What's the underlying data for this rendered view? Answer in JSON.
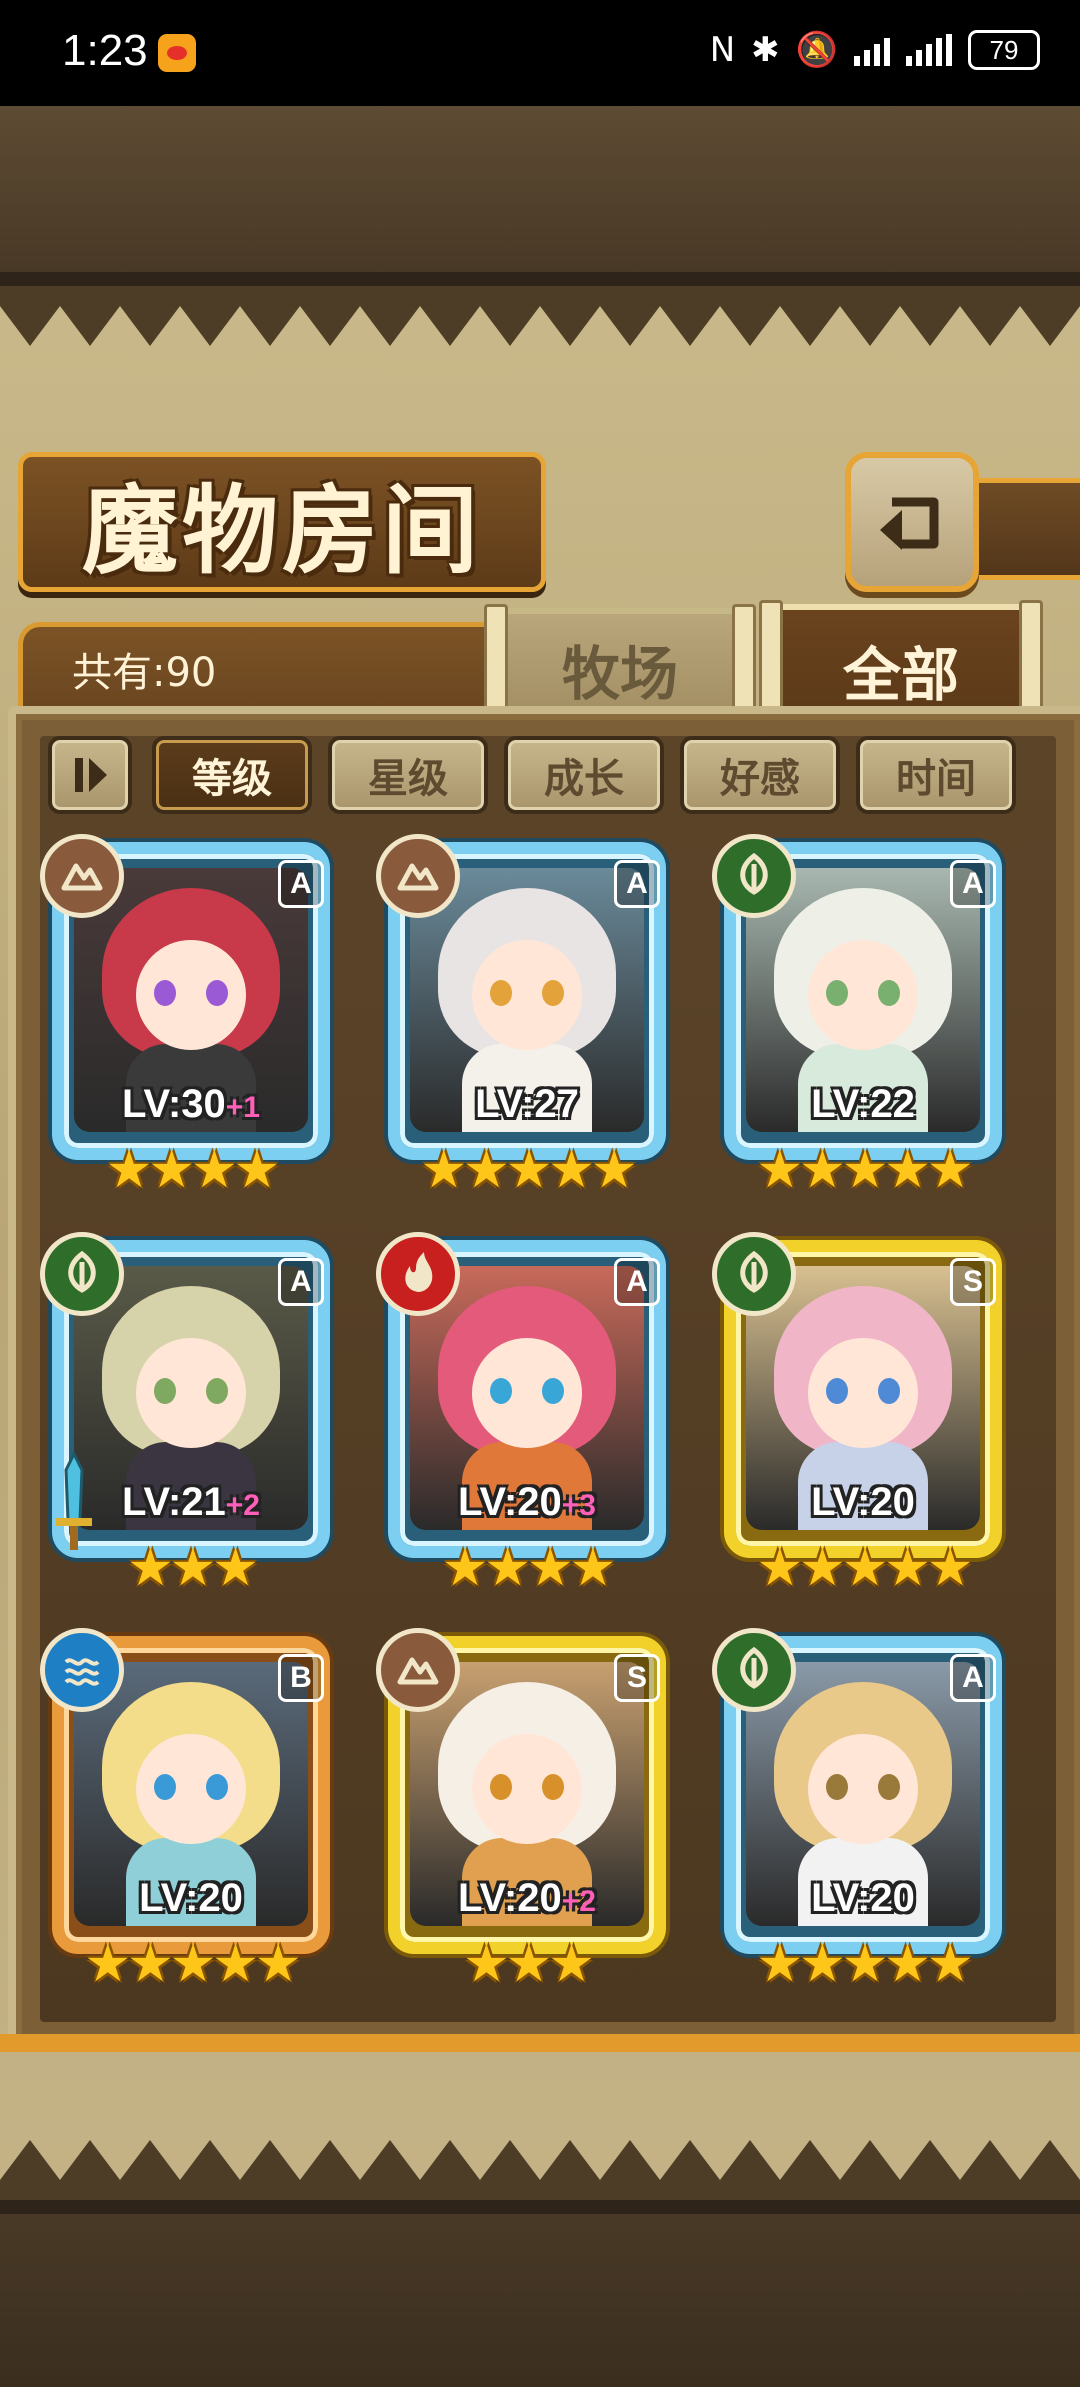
{
  "status_bar": {
    "time": "1:23",
    "battery": "79",
    "icons": [
      "weibo-icon",
      "nfc-icon",
      "bluetooth-icon",
      "mute-icon",
      "signal-icon",
      "signal-4g-icon"
    ]
  },
  "header": {
    "title": "魔物房间",
    "back_icon": "return-icon"
  },
  "tabs": {
    "count_label": "共有:90",
    "items": [
      {
        "label": "牧场",
        "active": false
      },
      {
        "label": "全部",
        "active": true
      }
    ]
  },
  "sort": {
    "toggle_icon": "reverse-order-icon",
    "options": [
      {
        "label": "等级",
        "active": true
      },
      {
        "label": "星级",
        "active": false
      },
      {
        "label": "成长",
        "active": false
      },
      {
        "label": "好感",
        "active": false
      },
      {
        "label": "时间",
        "active": false
      }
    ]
  },
  "colors": {
    "earth": "#8a5a3c",
    "wood": "#2f6e2a",
    "fire": "#c8201e",
    "water": "#1f7fc4",
    "frame_blue": "#7ccff0",
    "frame_gold": "#f2d22a",
    "frame_orange": "#e99a3a"
  },
  "monsters": [
    {
      "lv": "LV:30",
      "plus": "+1",
      "stars": "★★★★",
      "rank": "A",
      "element": "earth-icon",
      "frame": "blue"
    },
    {
      "lv": "LV:27",
      "plus": "",
      "stars": "★★★★★",
      "rank": "A",
      "element": "earth-icon",
      "frame": "blue"
    },
    {
      "lv": "LV:22",
      "plus": "",
      "stars": "★★★★★",
      "rank": "A",
      "element": "wood-icon",
      "frame": "blue"
    },
    {
      "lv": "LV:21",
      "plus": "+2",
      "stars": "★★★",
      "rank": "A",
      "element": "wood-icon",
      "frame": "blue"
    },
    {
      "lv": "LV:20",
      "plus": "+3",
      "stars": "★★★★",
      "rank": "A",
      "element": "fire-icon",
      "frame": "blue"
    },
    {
      "lv": "LV:20",
      "plus": "",
      "stars": "★★★★★",
      "rank": "S",
      "element": "wood-icon",
      "frame": "gold"
    },
    {
      "lv": "LV:20",
      "plus": "",
      "stars": "★★★★★",
      "rank": "B",
      "element": "water-icon",
      "frame": "orange"
    },
    {
      "lv": "LV:20",
      "plus": "+2",
      "stars": "★★★",
      "rank": "S",
      "element": "earth-icon",
      "frame": "gold"
    },
    {
      "lv": "LV:20",
      "plus": "",
      "stars": "★★★★★",
      "rank": "A",
      "element": "wood-icon",
      "frame": "blue"
    }
  ]
}
